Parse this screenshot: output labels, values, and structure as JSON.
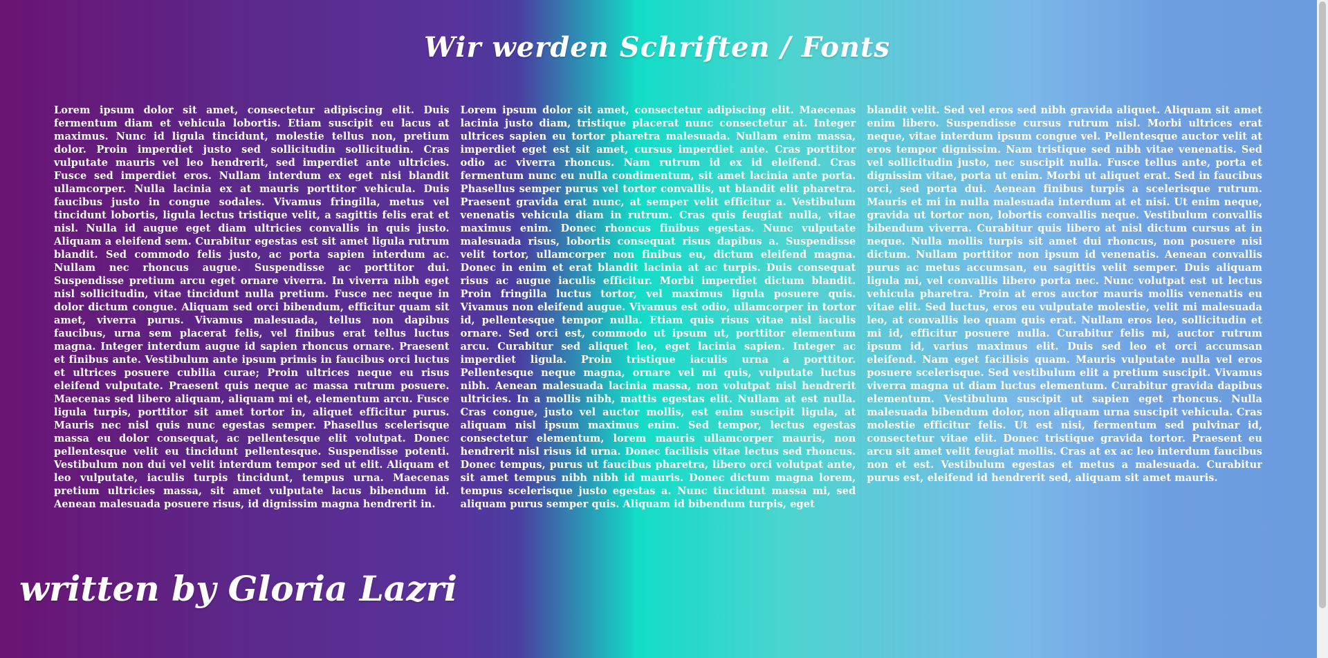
{
  "title": "Wir werden Schriften / Fonts",
  "columns": [
    "Lorem ipsum dolor sit amet, consectetur adipiscing elit. Duis fermentum diam et vehicula lobortis. Etiam suscipit eu lacus at maximus. Nunc id ligula tincidunt, molestie tellus non, pretium dolor. Proin imperdiet justo sed sollicitudin sollicitudin. Cras vulputate mauris vel leo hendrerit, sed imperdiet ante ultricies. Fusce sed imperdiet eros. Nullam interdum ex eget nisi blandit ullamcorper. Nulla lacinia ex at mauris porttitor vehicula. Duis faucibus justo in congue sodales. Vivamus fringilla, metus vel tincidunt lobortis, ligula lectus tristique velit, a sagittis felis erat et nisl. Nulla id augue eget diam ultricies convallis in quis justo. Aliquam a eleifend sem. Curabitur egestas est sit amet ligula rutrum blandit. Sed commodo felis justo, ac porta sapien interdum ac. Nullam nec rhoncus augue. Suspendisse ac porttitor dui. Suspendisse pretium arcu eget ornare viverra. In viverra nibh eget nisl sollicitudin, vitae tincidunt nulla pretium. Fusce nec neque in dolor dictum congue. Aliquam sed orci bibendum, efficitur quam sit amet, viverra purus. Vivamus malesuada, tellus non dapibus faucibus, urna sem placerat felis, vel finibus erat tellus luctus magna. Integer interdum augue id sapien rhoncus ornare. Praesent et finibus ante. Vestibulum ante ipsum primis in faucibus orci luctus et ultrices posuere cubilia curae; Proin ultrices neque eu risus eleifend vulputate. Praesent quis neque ac massa rutrum posuere. Maecenas sed libero aliquam, aliquam mi et, elementum arcu. Fusce ligula turpis, porttitor sit amet tortor in, aliquet efficitur purus. Mauris nec nisl quis nunc egestas semper. Phasellus scelerisque massa eu dolor consequat, ac pellentesque elit volutpat. Donec pellentesque velit eu tincidunt pellentesque. Suspendisse potenti. Vestibulum non dui vel velit interdum tempor sed ut elit. Aliquam et leo vulputate, iaculis turpis tincidunt, tempus urna. Maecenas pretium ultricies massa, sit amet vulputate lacus bibendum id. Aenean malesuada posuere risus, id dignissim magna hendrerit in.",
    "Lorem ipsum dolor sit amet, consectetur adipiscing elit. Maecenas lacinia justo diam, tristique placerat nunc consectetur at. Integer ultrices sapien eu tortor pharetra malesuada. Nullam enim massa, imperdiet eget est sit amet, cursus imperdiet ante. Cras porttitor odio ac viverra rhoncus. Nam rutrum id ex id eleifend. Cras fermentum nunc eu nulla condimentum, sit amet lacinia ante porta. Phasellus semper purus vel tortor convallis, ut blandit elit pharetra. Praesent gravida erat nunc, at semper velit efficitur a. Vestibulum venenatis vehicula diam in rutrum. Cras quis feugiat nulla, vitae maximus enim. Donec rhoncus finibus egestas. Nunc vulputate malesuada risus, lobortis consequat risus dapibus a. Suspendisse velit tortor, ullamcorper non finibus eu, dictum eleifend magna. Donec in enim et erat blandit lacinia at ac turpis. Duis consequat risus ac augue iaculis efficitur. Morbi imperdiet dictum blandit. Proin fringilla luctus tortor, vel maximus ligula posuere quis. Vivamus non eleifend augue. Vivamus est odio, ullamcorper in tortor id, pellentesque tempor nulla. Etiam quis risus vitae nisl iaculis ornare. Sed orci est, commodo ut ipsum ut, porttitor elementum arcu. Curabitur sed aliquet leo, eget lacinia sapien. Integer ac imperdiet ligula. Proin tristique iaculis urna a porttitor. Pellentesque neque magna, ornare vel mi quis, vulputate luctus nibh. Aenean malesuada lacinia massa, non volutpat nisl hendrerit ultricies. In a mollis nibh, mattis egestas elit. Nullam at est nulla. Cras congue, justo vel auctor mollis, est enim suscipit ligula, at aliquam nisl ipsum maximus enim. Sed tempor, lectus egestas consectetur elementum, lorem mauris ullamcorper mauris, non hendrerit nisl risus id urna. Donec facilisis vitae lectus sed rhoncus. Donec tempus, purus ut faucibus pharetra, libero orci volutpat ante, sit amet tempus nibh nibh id mauris. Donec dictum magna lorem, tempus scelerisque justo egestas a. Nunc tincidunt massa mi, sed aliquam purus semper quis. Aliquam id bibendum turpis, eget",
    "blandit velit. Sed vel eros sed nibh gravida aliquet. Aliquam sit amet enim libero. Suspendisse cursus rutrum nisl. Morbi ultrices erat neque, vitae interdum ipsum congue vel. Pellentesque auctor velit at eros tempor dignissim. Nam tristique sed nibh vitae venenatis. Sed vel sollicitudin justo, nec suscipit nulla. Fusce tellus ante, porta et dignissim vitae, porta ut enim. Morbi ut aliquet erat. Sed in faucibus orci, sed porta dui. Aenean finibus turpis a scelerisque rutrum. Mauris et mi in nulla malesuada interdum at et nisi. Ut enim neque, gravida ut tortor non, lobortis convallis neque. Vestibulum convallis bibendum viverra. Curabitur quis libero at nisl dictum cursus at in neque. Nulla mollis turpis sit amet dui rhoncus, non posuere nisi dictum. Nullam porttitor non ipsum id venenatis. Aenean convallis purus ac metus accumsan, eu sagittis velit semper. Duis aliquam ligula mi, vel convallis libero porta nec. Nunc volutpat est ut lectus vehicula pharetra. Proin at eros auctor mauris mollis venenatis eu vitae elit. Sed luctus, eros eu vulputate molestie, velit mi malesuada leo, at convallis leo quam quis erat. Nullam eros leo, sollicitudin et mi id, efficitur posuere nulla. Curabitur felis mi, auctor rutrum ipsum id, varius maximus elit. Duis sed leo et orci accumsan eleifend. Nam eget facilisis quam. Mauris vulputate nulla vel eros posuere scelerisque. Sed vestibulum elit a pretium suscipit. Vivamus viverra magna ut diam luctus elementum. Curabitur gravida dapibus elementum. Vestibulum suscipit ut sapien eget rhoncus. Nulla malesuada bibendum dolor, non aliquam urna suscipit vehicula. Cras molestie efficitur felis. Ut est nisi, fermentum sed pulvinar id, consectetur vitae elit. Donec tristique gravida tortor. Praesent eu arcu sit amet velit feugiat mollis. Cras at ex ac leo interdum faucibus non et est. Vestibulum egestas et metus a malesuada. Curabitur purus est, eleifend id hendrerit sed, aliquam sit amet mauris."
  ],
  "footer": "written by Gloria Lazri"
}
